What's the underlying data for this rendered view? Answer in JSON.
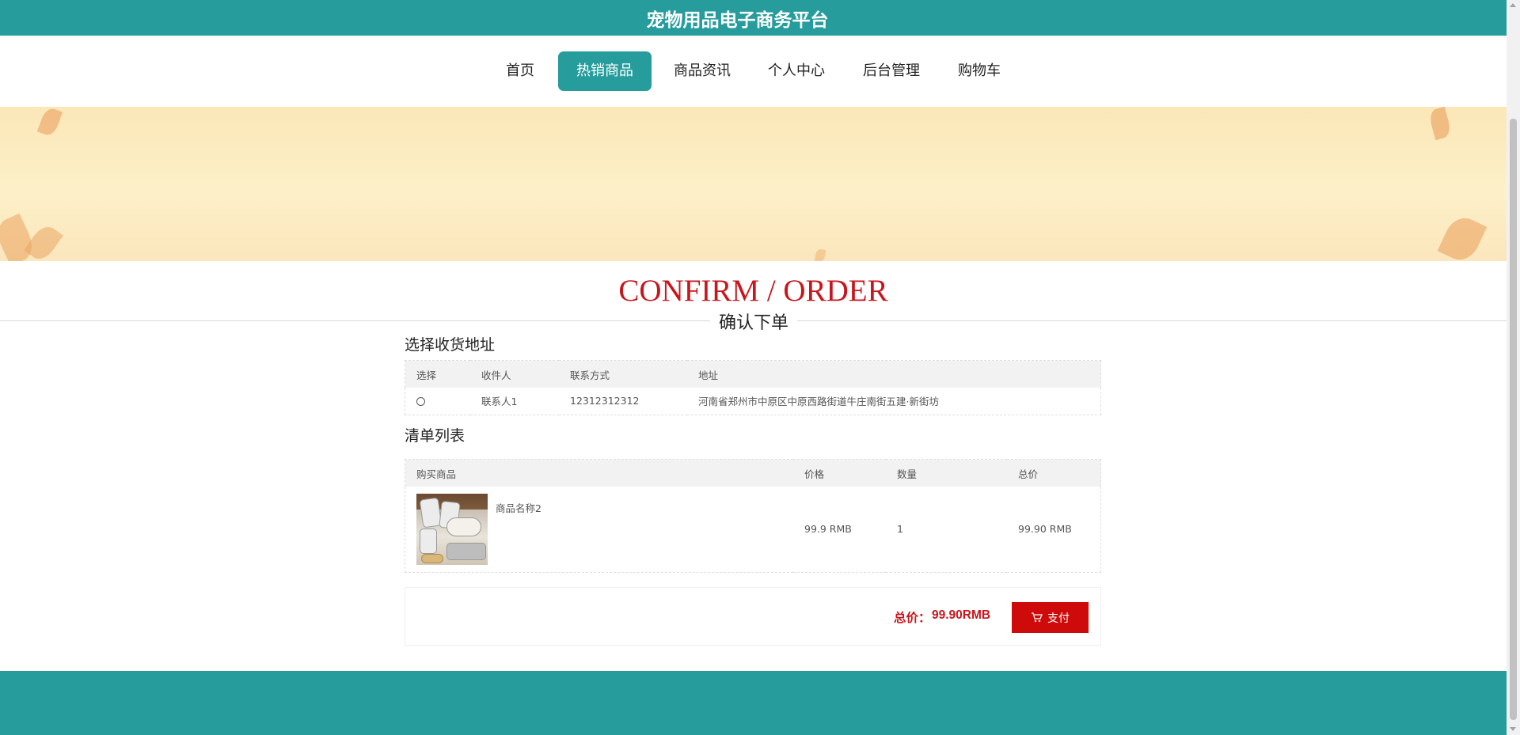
{
  "header": {
    "site_title": "宠物用品电子商务平台",
    "accent_color": "#279c9c"
  },
  "nav": {
    "items": [
      {
        "label": "首页",
        "active": false
      },
      {
        "label": "热销商品",
        "active": true
      },
      {
        "label": "商品资讯",
        "active": false
      },
      {
        "label": "个人中心",
        "active": false
      },
      {
        "label": "后台管理",
        "active": false
      },
      {
        "label": "购物车",
        "active": false
      }
    ]
  },
  "page": {
    "title_en": "CONFIRM / ORDER",
    "title_cn": "确认下单",
    "title_color": "#c8161d"
  },
  "address": {
    "section_title": "选择收货地址",
    "columns": [
      "选择",
      "收件人",
      "联系方式",
      "地址"
    ],
    "rows": [
      {
        "selected": false,
        "recipient": "联系人1",
        "phone": "12312312312",
        "address": "河南省郑州市中原区中原西路街道牛庄南街五建·新街坊"
      }
    ]
  },
  "items": {
    "section_title": "清单列表",
    "columns": [
      "购买商品",
      "价格",
      "数量",
      "总价"
    ],
    "rows": [
      {
        "name": "商品名称2",
        "price": "99.9 RMB",
        "qty": "1",
        "total": "99.90 RMB",
        "image_icon": "pet-tag-product-photo"
      }
    ]
  },
  "summary": {
    "total_label": "总价：",
    "total_value": "99.90RMB",
    "pay_label": "支付",
    "pay_icon": "cart-icon",
    "pay_color": "#cf0a0a"
  }
}
